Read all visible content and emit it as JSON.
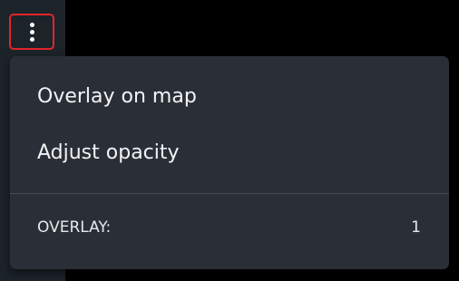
{
  "toolbar": {
    "more_button_icon": "more-vertical-icon",
    "highlight_color": "#e0262b"
  },
  "menu": {
    "items": [
      {
        "label": "Overlay on map"
      },
      {
        "label": "Adjust opacity"
      }
    ],
    "overlay": {
      "label": "OVERLAY:",
      "value": "1"
    }
  },
  "colors": {
    "menu_background": "#2a2f37",
    "text": "#f2f3f4",
    "sidebar": "#1c2329"
  }
}
